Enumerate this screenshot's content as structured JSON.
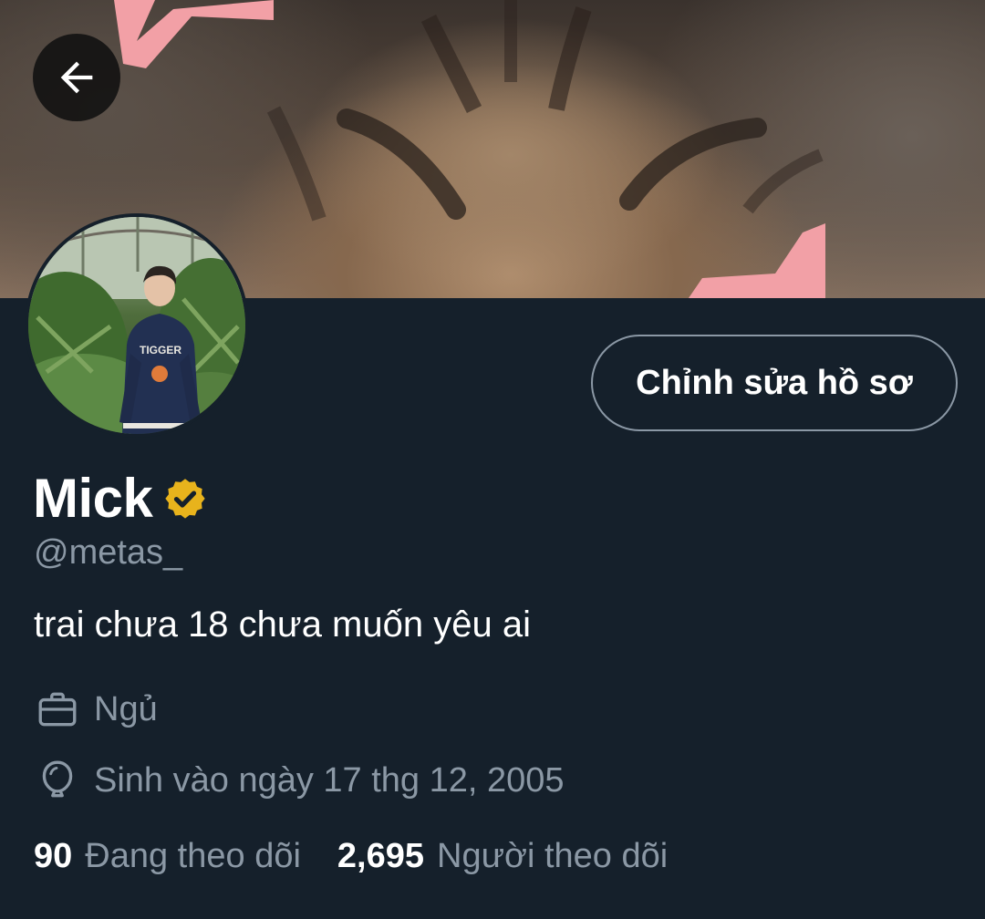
{
  "header": {
    "back_icon": "arrow-left-icon",
    "banner_description_icon": "cat-photo-banner"
  },
  "profile": {
    "display_name": "Mick",
    "verified_icon": "verified-badge-icon",
    "handle": "@metas_",
    "bio": "trai chưa 18 chưa muốn yêu ai",
    "edit_button_label": "Chỉnh sửa hồ sơ",
    "job": {
      "icon": "briefcase-icon",
      "text": "Ngủ"
    },
    "birthday": {
      "icon": "balloon-icon",
      "text": "Sinh vào ngày 17 thg 12, 2005"
    }
  },
  "stats": {
    "following": {
      "count": "90",
      "label": "Đang theo dõi"
    },
    "followers": {
      "count": "2,695",
      "label": "Người theo dõi"
    }
  },
  "colors": {
    "background": "#15202b",
    "secondary_text": "#8b98a5",
    "verified_gold": "#e8b31c",
    "primary_text": "#ffffff"
  }
}
